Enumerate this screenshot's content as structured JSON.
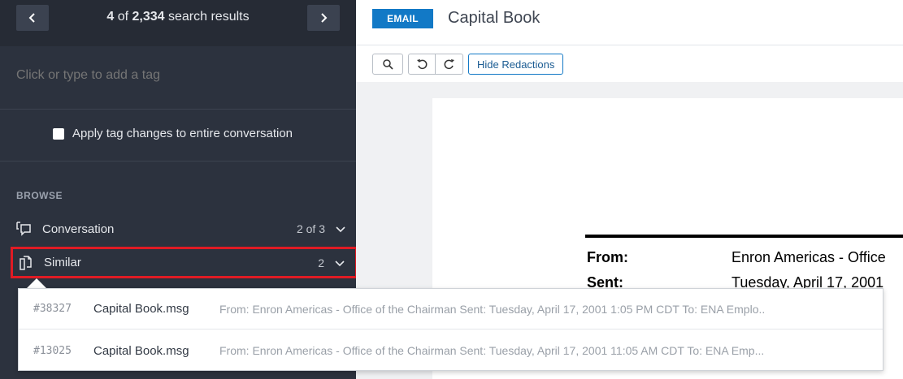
{
  "nav": {
    "current": "4",
    "of_text": " of ",
    "total": "2,334",
    "suffix": " search results"
  },
  "tags": {
    "placeholder": "Click or type to add a tag"
  },
  "apply": {
    "label": "Apply tag changes to entire conversation",
    "checked": false
  },
  "browse": {
    "label": "BROWSE",
    "items": [
      {
        "label": "Conversation",
        "count": "2 of 3",
        "icon": "conversation-icon"
      },
      {
        "label": "Similar",
        "count": "2",
        "icon": "similar-docs-icon"
      }
    ]
  },
  "similar_results": [
    {
      "id": "#38327",
      "name": "Capital Book.msg",
      "snippet": "From: Enron Americas - Office of the Chairman Sent: Tuesday, April 17, 2001 1:05 PM CDT To: ENA Emplo.."
    },
    {
      "id": "#13025",
      "name": "Capital Book.msg",
      "snippet": "From: Enron Americas - Office of the Chairman Sent: Tuesday, April 17, 2001 11:05 AM CDT To: ENA Emp..."
    }
  ],
  "header": {
    "badge": "EMAIL",
    "title": "Capital Book"
  },
  "toolbar": {
    "hide_redactions": "Hide Redactions"
  },
  "document": {
    "from_label": "From:",
    "from_value": "Enron Americas - Office",
    "sent_label": "Sent:",
    "sent_value": "Tuesday, April 17, 2001"
  },
  "colors": {
    "sidebar_bg": "#2c323e",
    "accent": "#1279c6",
    "highlight": "#e01b24"
  }
}
